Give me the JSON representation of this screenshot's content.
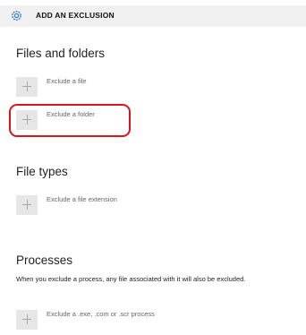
{
  "header": {
    "icon": "gear-icon",
    "title": "ADD AN EXCLUSION"
  },
  "files_and_folders": {
    "title": "Files and folders",
    "items": [
      {
        "icon": "plus-icon",
        "label": "Exclude a file"
      },
      {
        "icon": "plus-icon",
        "label": "Exclude a folder"
      }
    ]
  },
  "file_types": {
    "title": "File types",
    "items": [
      {
        "icon": "plus-icon",
        "label": "Exclude a file extension"
      }
    ]
  },
  "processes": {
    "title": "Processes",
    "description": "When you exclude a process, any file associated with it will also be excluded.",
    "items": [
      {
        "icon": "plus-icon",
        "label": "Exclude a .exe, .com or .scr process"
      }
    ]
  },
  "colors": {
    "header_bg": "#f0f0f0",
    "accent": "#2b73c8",
    "annotation": "#d9141f"
  }
}
